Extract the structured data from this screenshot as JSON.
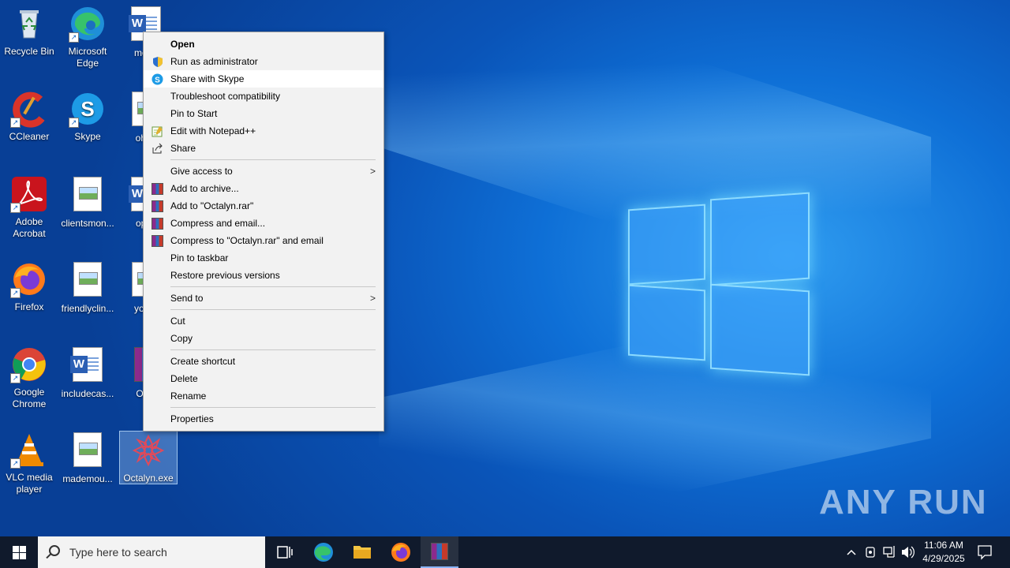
{
  "desktop": {
    "icons": [
      {
        "label": "Recycle Bin",
        "icon": "recycle-bin-icon"
      },
      {
        "label": "Microsoft Edge",
        "icon": "edge-icon"
      },
      {
        "label": "mode",
        "icon": "word-doc-icon"
      },
      {
        "label": "CCleaner",
        "icon": "ccleaner-icon"
      },
      {
        "label": "Skype",
        "icon": "skype-icon"
      },
      {
        "label": "ohpa",
        "icon": "doc-icon"
      },
      {
        "label": "Adobe Acrobat",
        "icon": "acrobat-icon"
      },
      {
        "label": "clientsmon...",
        "icon": "image-doc-icon"
      },
      {
        "label": "optio",
        "icon": "word-doc-icon"
      },
      {
        "label": "Firefox",
        "icon": "firefox-icon"
      },
      {
        "label": "friendlyclin...",
        "icon": "image-doc-icon"
      },
      {
        "label": "yourn",
        "icon": "doc-icon"
      },
      {
        "label": "Google Chrome",
        "icon": "chrome-icon"
      },
      {
        "label": "includecas...",
        "icon": "word-doc-icon"
      },
      {
        "label": "Octa",
        "icon": "winrar-icon"
      },
      {
        "label": "VLC media player",
        "icon": "vlc-icon"
      },
      {
        "label": "mademou...",
        "icon": "image-doc-icon"
      },
      {
        "label": "Octalyn.exe",
        "icon": "octalyn-icon"
      }
    ]
  },
  "context_menu": {
    "items": [
      {
        "label": "Open"
      },
      {
        "label": "Run as administrator",
        "icon": "shield-icon"
      },
      {
        "label": "Share with Skype",
        "icon": "skype-icon"
      },
      {
        "label": "Troubleshoot compatibility"
      },
      {
        "label": "Pin to Start"
      },
      {
        "label": "Edit with Notepad++",
        "icon": "notepad-plus-plus-icon"
      },
      {
        "label": "Share",
        "icon": "share-icon"
      },
      {
        "label": "Give access to"
      },
      {
        "label": "Add to archive...",
        "icon": "winrar-icon"
      },
      {
        "label": "Add to \"Octalyn.rar\"",
        "icon": "winrar-icon"
      },
      {
        "label": "Compress and email...",
        "icon": "winrar-icon"
      },
      {
        "label": "Compress to \"Octalyn.rar\" and email",
        "icon": "winrar-icon"
      },
      {
        "label": "Pin to taskbar"
      },
      {
        "label": "Restore previous versions"
      },
      {
        "label": "Send to"
      },
      {
        "label": "Cut"
      },
      {
        "label": "Copy"
      },
      {
        "label": "Create shortcut"
      },
      {
        "label": "Delete"
      },
      {
        "label": "Rename"
      },
      {
        "label": "Properties"
      }
    ]
  },
  "taskbar": {
    "search_placeholder": "Type here to search",
    "pinned": [
      "task-view-icon",
      "edge-icon",
      "file-explorer-icon",
      "firefox-icon",
      "winrar-icon"
    ],
    "time": "11:06 AM",
    "date": "4/29/2025"
  },
  "watermark": {
    "text": "ANY RUN"
  },
  "colors": {
    "taskbar": "#101a2c",
    "menu_bg": "#f2f2f2",
    "desktop_accent": "#0e6fd6"
  }
}
